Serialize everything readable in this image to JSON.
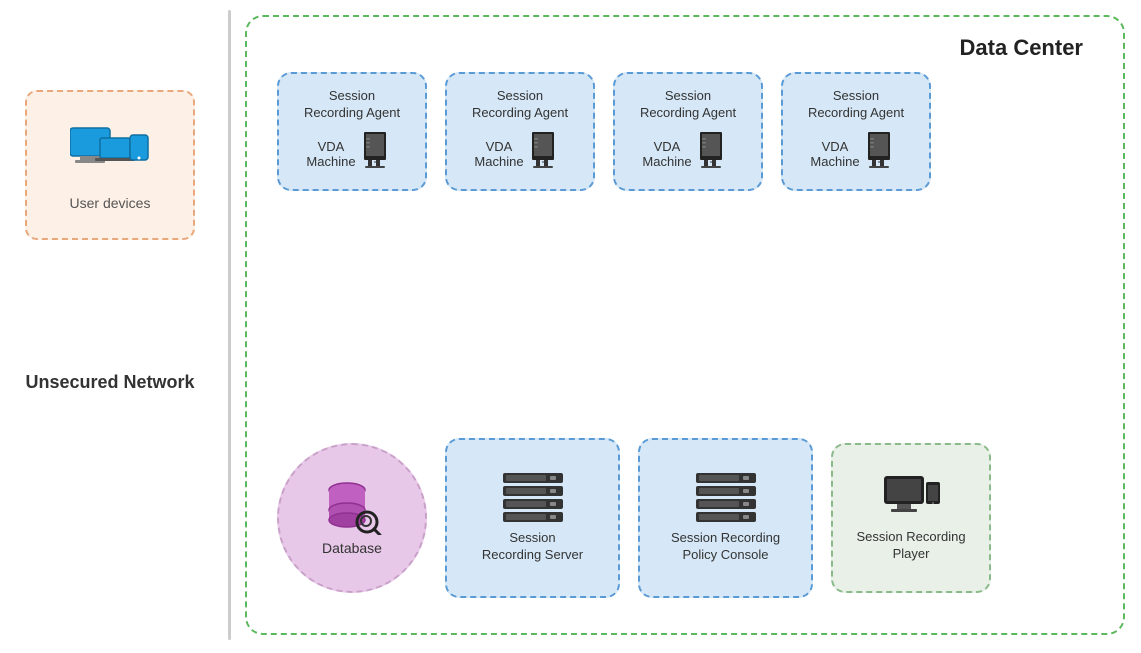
{
  "left": {
    "unsecured_network": "Unsecured\nNetwork",
    "user_devices_label": "User devices"
  },
  "data_center": {
    "title": "Data Center",
    "vda_boxes": [
      {
        "id": "vda1",
        "agent_line1": "Session",
        "agent_line2": "Recording Agent",
        "machine_line1": "VDA",
        "machine_line2": "Machine"
      },
      {
        "id": "vda2",
        "agent_line1": "Session",
        "agent_line2": "Recording Agent",
        "machine_line1": "VDA",
        "machine_line2": "Machine"
      },
      {
        "id": "vda3",
        "agent_line1": "Session",
        "agent_line2": "Recording Agent",
        "machine_line1": "VDA",
        "machine_line2": "Machine"
      },
      {
        "id": "vda4",
        "agent_line1": "Session",
        "agent_line2": "Recording Agent",
        "machine_line1": "VDA",
        "machine_line2": "Machine"
      }
    ],
    "database_label": "Database",
    "server_label": "Session\nRecording Server",
    "policy_label": "Session Recording\nPolicy Console",
    "player_label": "Session Recording\nPlayer"
  }
}
